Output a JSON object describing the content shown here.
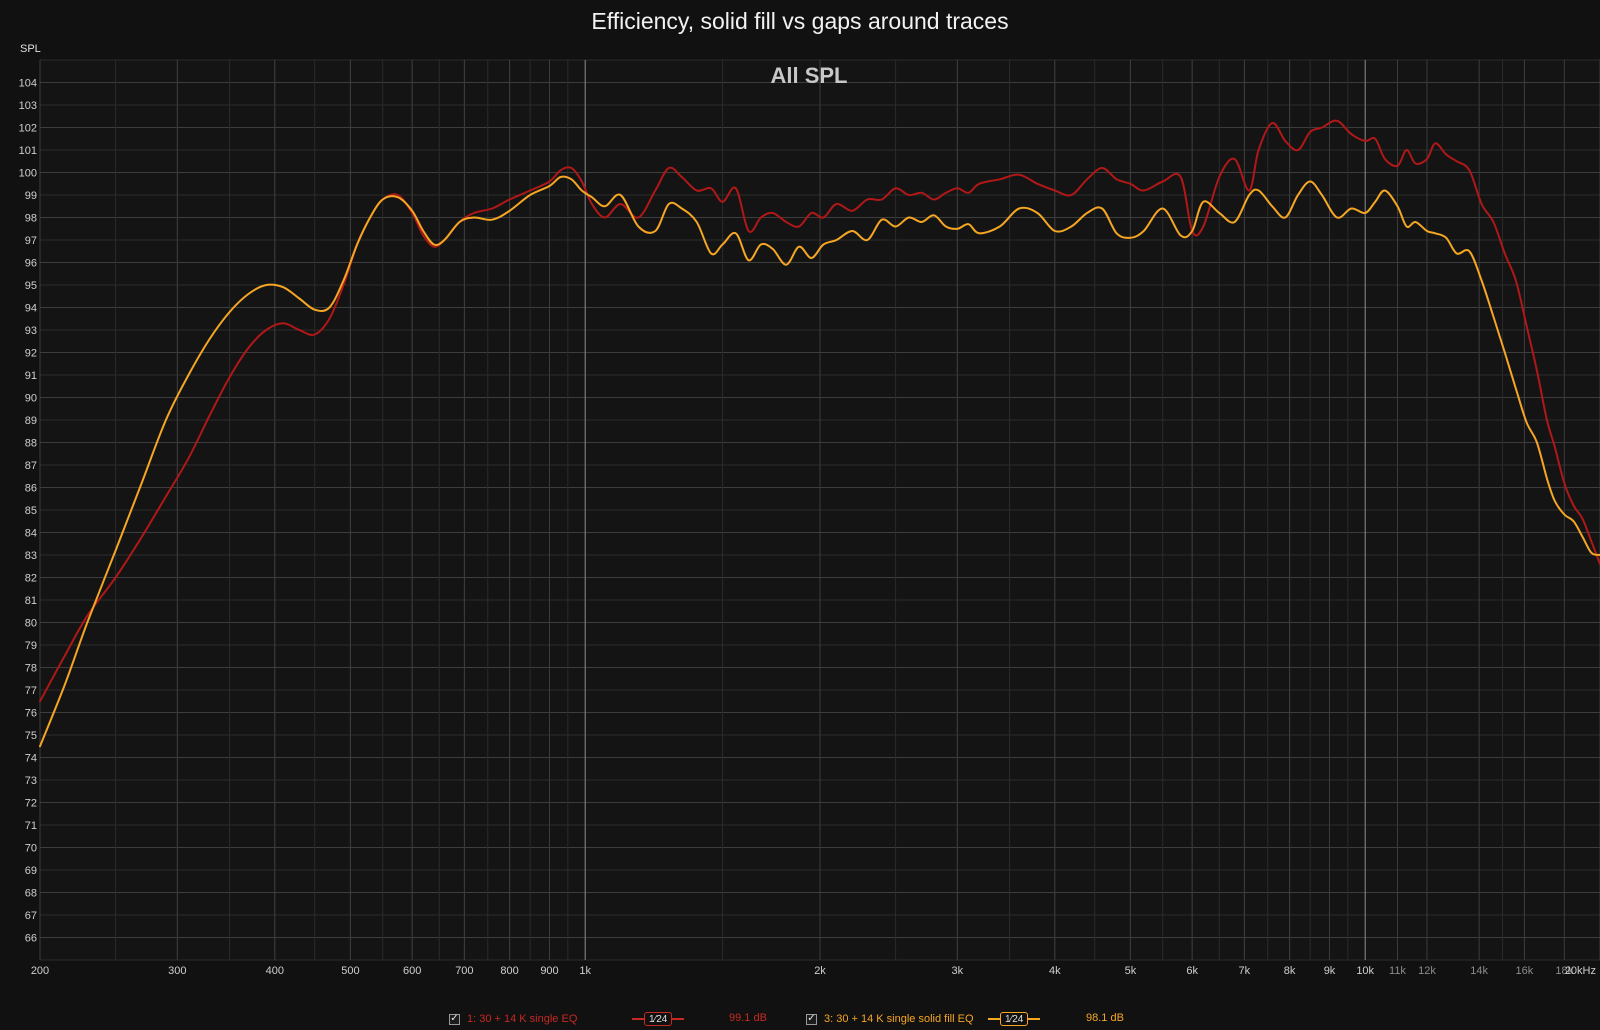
{
  "title": "Efficiency, solid fill vs gaps around traces",
  "y_unit": "SPL",
  "plot_heading": "All SPL",
  "colors": {
    "background": "#111111",
    "series1": "#b01818",
    "series2": "#f5a623"
  },
  "legend": {
    "items": [
      {
        "checked": "✓",
        "label": "1: 30 + 14 K single EQ",
        "smoothing": "1⁄24",
        "level": "99.1 dB",
        "color": "#c42a22"
      },
      {
        "checked": "✓",
        "label": "3: 30 + 14 K single solid fill EQ",
        "smoothing": "1⁄24",
        "level": "98.1 dB",
        "color": "#f5a623"
      }
    ]
  },
  "chart_data": {
    "type": "line",
    "title": "Efficiency, solid fill vs gaps around traces",
    "subtitle": "All SPL",
    "ylabel": "SPL",
    "xlabel": "",
    "xscale": "log",
    "xlim": [
      200,
      20000
    ],
    "ylim": [
      65,
      105
    ],
    "grid": true,
    "legend_position": "bottom",
    "x_ticks": [
      {
        "v": 200,
        "label": "200"
      },
      {
        "v": 300,
        "label": "300"
      },
      {
        "v": 400,
        "label": "400"
      },
      {
        "v": 500,
        "label": "500"
      },
      {
        "v": 600,
        "label": "600"
      },
      {
        "v": 700,
        "label": "700"
      },
      {
        "v": 800,
        "label": "800"
      },
      {
        "v": 900,
        "label": "900"
      },
      {
        "v": 1000,
        "label": "1k"
      },
      {
        "v": 2000,
        "label": "2k"
      },
      {
        "v": 3000,
        "label": "3k"
      },
      {
        "v": 4000,
        "label": "4k"
      },
      {
        "v": 5000,
        "label": "5k"
      },
      {
        "v": 6000,
        "label": "6k"
      },
      {
        "v": 7000,
        "label": "7k"
      },
      {
        "v": 8000,
        "label": "8k"
      },
      {
        "v": 9000,
        "label": "9k"
      },
      {
        "v": 10000,
        "label": "10k"
      },
      {
        "v": 11000,
        "label": "11k"
      },
      {
        "v": 12000,
        "label": "12k"
      },
      {
        "v": 14000,
        "label": "14k"
      },
      {
        "v": 16000,
        "label": "16k"
      },
      {
        "v": 18000,
        "label": "18k"
      },
      {
        "v": 20000,
        "label": "20kHz"
      }
    ],
    "y_ticks": [
      66,
      67,
      68,
      69,
      70,
      71,
      72,
      73,
      74,
      75,
      76,
      77,
      78,
      79,
      80,
      81,
      82,
      83,
      84,
      85,
      86,
      87,
      88,
      89,
      90,
      91,
      92,
      93,
      94,
      95,
      96,
      97,
      98,
      99,
      100,
      101,
      102,
      103,
      104
    ],
    "series": [
      {
        "name": "1: 30 + 14 K single EQ",
        "color": "#b01818",
        "points": [
          [
            200,
            76.5
          ],
          [
            215,
            78.5
          ],
          [
            230,
            80.3
          ],
          [
            250,
            82.0
          ],
          [
            270,
            83.8
          ],
          [
            290,
            85.6
          ],
          [
            310,
            87.3
          ],
          [
            330,
            89.2
          ],
          [
            350,
            90.9
          ],
          [
            370,
            92.2
          ],
          [
            390,
            93.0
          ],
          [
            410,
            93.3
          ],
          [
            430,
            93.0
          ],
          [
            450,
            92.8
          ],
          [
            470,
            93.5
          ],
          [
            490,
            95.0
          ],
          [
            510,
            96.8
          ],
          [
            530,
            98.0
          ],
          [
            550,
            98.8
          ],
          [
            575,
            99.0
          ],
          [
            600,
            98.2
          ],
          [
            620,
            97.2
          ],
          [
            640,
            96.7
          ],
          [
            660,
            97.0
          ],
          [
            690,
            97.8
          ],
          [
            720,
            98.2
          ],
          [
            760,
            98.4
          ],
          [
            800,
            98.8
          ],
          [
            850,
            99.2
          ],
          [
            900,
            99.6
          ],
          [
            930,
            100.1
          ],
          [
            960,
            100.2
          ],
          [
            990,
            99.6
          ],
          [
            1020,
            98.6
          ],
          [
            1060,
            98.0
          ],
          [
            1110,
            98.6
          ],
          [
            1170,
            98.0
          ],
          [
            1230,
            99.2
          ],
          [
            1280,
            100.2
          ],
          [
            1330,
            99.8
          ],
          [
            1390,
            99.2
          ],
          [
            1450,
            99.3
          ],
          [
            1500,
            98.7
          ],
          [
            1560,
            99.3
          ],
          [
            1620,
            97.4
          ],
          [
            1680,
            98.0
          ],
          [
            1740,
            98.2
          ],
          [
            1810,
            97.8
          ],
          [
            1880,
            97.6
          ],
          [
            1950,
            98.2
          ],
          [
            2020,
            98.0
          ],
          [
            2100,
            98.6
          ],
          [
            2200,
            98.3
          ],
          [
            2300,
            98.8
          ],
          [
            2400,
            98.8
          ],
          [
            2500,
            99.3
          ],
          [
            2600,
            99.0
          ],
          [
            2700,
            99.1
          ],
          [
            2800,
            98.8
          ],
          [
            2900,
            99.1
          ],
          [
            3000,
            99.3
          ],
          [
            3100,
            99.1
          ],
          [
            3200,
            99.5
          ],
          [
            3400,
            99.7
          ],
          [
            3600,
            99.9
          ],
          [
            3800,
            99.5
          ],
          [
            4000,
            99.2
          ],
          [
            4200,
            99.0
          ],
          [
            4400,
            99.7
          ],
          [
            4600,
            100.2
          ],
          [
            4800,
            99.7
          ],
          [
            5000,
            99.5
          ],
          [
            5200,
            99.2
          ],
          [
            5500,
            99.6
          ],
          [
            5800,
            99.8
          ],
          [
            6000,
            97.4
          ],
          [
            6200,
            97.6
          ],
          [
            6500,
            99.8
          ],
          [
            6800,
            100.6
          ],
          [
            7100,
            99.2
          ],
          [
            7300,
            101.0
          ],
          [
            7600,
            102.2
          ],
          [
            7900,
            101.4
          ],
          [
            8200,
            101.0
          ],
          [
            8500,
            101.8
          ],
          [
            8800,
            102.0
          ],
          [
            9200,
            102.3
          ],
          [
            9600,
            101.7
          ],
          [
            10000,
            101.4
          ],
          [
            10300,
            101.5
          ],
          [
            10600,
            100.6
          ],
          [
            11000,
            100.3
          ],
          [
            11300,
            101.0
          ],
          [
            11600,
            100.4
          ],
          [
            12000,
            100.6
          ],
          [
            12300,
            101.3
          ],
          [
            12700,
            100.8
          ],
          [
            13100,
            100.5
          ],
          [
            13600,
            100.1
          ],
          [
            14100,
            98.6
          ],
          [
            14600,
            97.8
          ],
          [
            15100,
            96.4
          ],
          [
            15600,
            95.2
          ],
          [
            16100,
            93.2
          ],
          [
            16600,
            91.2
          ],
          [
            17100,
            89.0
          ],
          [
            17500,
            87.8
          ],
          [
            18000,
            86.2
          ],
          [
            18500,
            85.2
          ],
          [
            19000,
            84.6
          ],
          [
            19500,
            83.6
          ],
          [
            20000,
            82.6
          ]
        ]
      },
      {
        "name": "3: 30 + 14 K single solid fill EQ",
        "color": "#f5a623",
        "points": [
          [
            200,
            74.5
          ],
          [
            215,
            77.2
          ],
          [
            230,
            80.0
          ],
          [
            250,
            83.2
          ],
          [
            270,
            86.2
          ],
          [
            290,
            89.0
          ],
          [
            310,
            91.0
          ],
          [
            330,
            92.6
          ],
          [
            350,
            93.8
          ],
          [
            370,
            94.6
          ],
          [
            390,
            95.0
          ],
          [
            410,
            94.9
          ],
          [
            430,
            94.4
          ],
          [
            450,
            93.9
          ],
          [
            470,
            94.0
          ],
          [
            490,
            95.2
          ],
          [
            510,
            96.8
          ],
          [
            530,
            98.0
          ],
          [
            550,
            98.8
          ],
          [
            575,
            98.9
          ],
          [
            600,
            98.3
          ],
          [
            620,
            97.4
          ],
          [
            640,
            96.8
          ],
          [
            660,
            97.0
          ],
          [
            690,
            97.8
          ],
          [
            720,
            98.0
          ],
          [
            760,
            97.9
          ],
          [
            800,
            98.3
          ],
          [
            850,
            99.0
          ],
          [
            900,
            99.4
          ],
          [
            930,
            99.8
          ],
          [
            960,
            99.7
          ],
          [
            990,
            99.2
          ],
          [
            1020,
            98.9
          ],
          [
            1060,
            98.5
          ],
          [
            1110,
            99.0
          ],
          [
            1170,
            97.6
          ],
          [
            1230,
            97.4
          ],
          [
            1280,
            98.6
          ],
          [
            1330,
            98.4
          ],
          [
            1390,
            97.8
          ],
          [
            1450,
            96.4
          ],
          [
            1500,
            96.8
          ],
          [
            1560,
            97.3
          ],
          [
            1620,
            96.1
          ],
          [
            1680,
            96.8
          ],
          [
            1740,
            96.6
          ],
          [
            1810,
            95.9
          ],
          [
            1880,
            96.7
          ],
          [
            1950,
            96.2
          ],
          [
            2020,
            96.8
          ],
          [
            2100,
            97.0
          ],
          [
            2200,
            97.4
          ],
          [
            2300,
            97.0
          ],
          [
            2400,
            97.9
          ],
          [
            2500,
            97.6
          ],
          [
            2600,
            98.0
          ],
          [
            2700,
            97.8
          ],
          [
            2800,
            98.1
          ],
          [
            2900,
            97.6
          ],
          [
            3000,
            97.5
          ],
          [
            3100,
            97.7
          ],
          [
            3200,
            97.3
          ],
          [
            3400,
            97.6
          ],
          [
            3600,
            98.4
          ],
          [
            3800,
            98.2
          ],
          [
            4000,
            97.4
          ],
          [
            4200,
            97.6
          ],
          [
            4400,
            98.2
          ],
          [
            4600,
            98.4
          ],
          [
            4800,
            97.3
          ],
          [
            5000,
            97.1
          ],
          [
            5200,
            97.4
          ],
          [
            5500,
            98.4
          ],
          [
            5800,
            97.2
          ],
          [
            6000,
            97.4
          ],
          [
            6200,
            98.7
          ],
          [
            6500,
            98.2
          ],
          [
            6800,
            97.8
          ],
          [
            7100,
            99.0
          ],
          [
            7300,
            99.2
          ],
          [
            7600,
            98.5
          ],
          [
            7900,
            98.0
          ],
          [
            8200,
            99.0
          ],
          [
            8500,
            99.6
          ],
          [
            8800,
            99.0
          ],
          [
            9200,
            98.0
          ],
          [
            9600,
            98.4
          ],
          [
            10000,
            98.2
          ],
          [
            10300,
            98.7
          ],
          [
            10600,
            99.2
          ],
          [
            11000,
            98.5
          ],
          [
            11300,
            97.6
          ],
          [
            11600,
            97.8
          ],
          [
            12000,
            97.4
          ],
          [
            12300,
            97.3
          ],
          [
            12700,
            97.1
          ],
          [
            13100,
            96.4
          ],
          [
            13600,
            96.5
          ],
          [
            14100,
            95.2
          ],
          [
            14600,
            93.6
          ],
          [
            15100,
            92.0
          ],
          [
            15600,
            90.4
          ],
          [
            16100,
            88.9
          ],
          [
            16600,
            88.0
          ],
          [
            17100,
            86.4
          ],
          [
            17500,
            85.4
          ],
          [
            18000,
            84.8
          ],
          [
            18500,
            84.5
          ],
          [
            19000,
            83.8
          ],
          [
            19500,
            83.1
          ],
          [
            20000,
            83.0
          ]
        ]
      }
    ]
  }
}
